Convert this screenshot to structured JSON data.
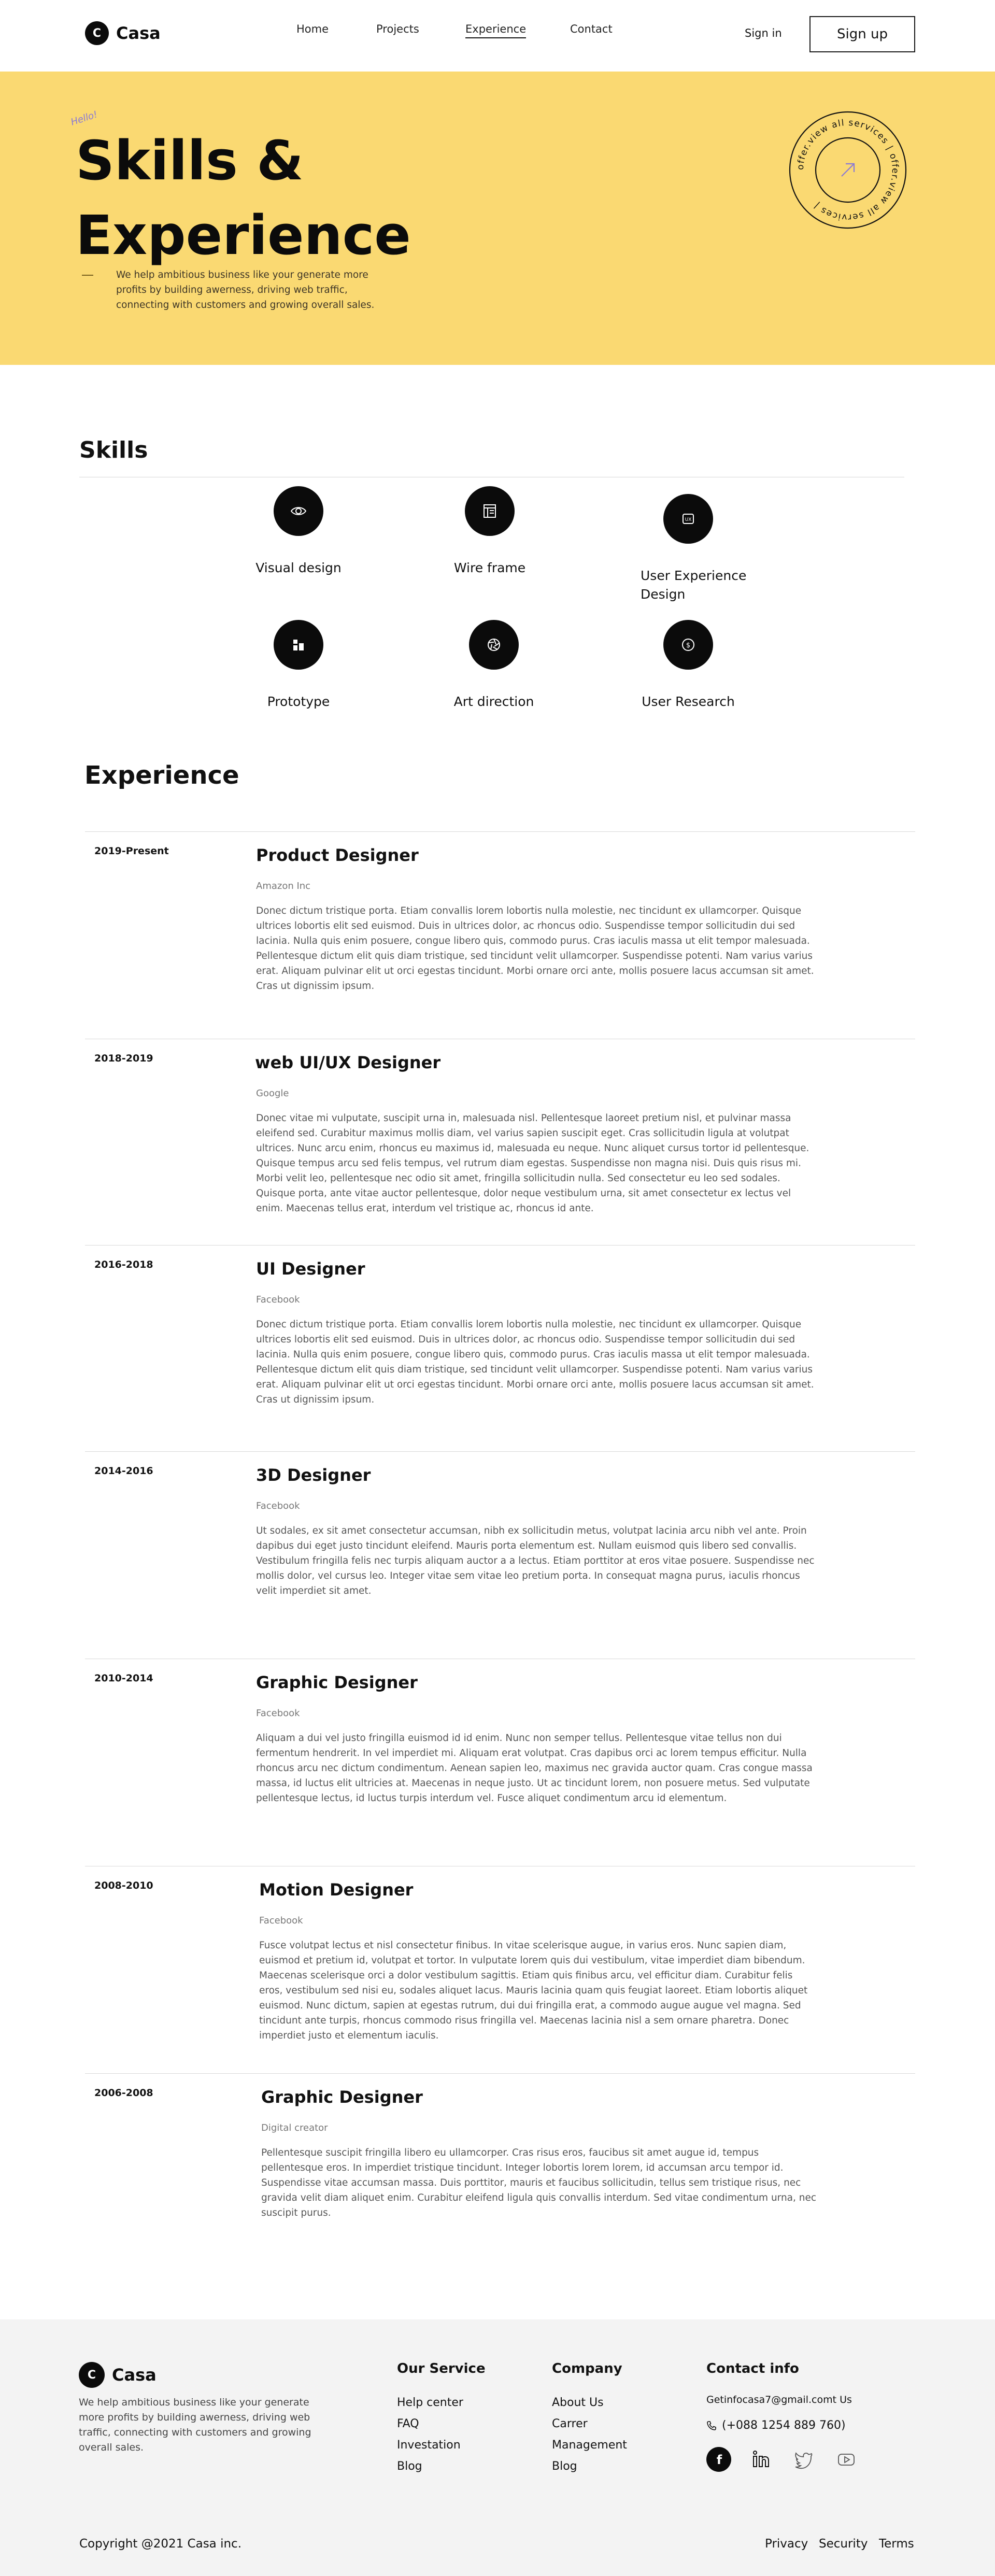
{
  "brand": {
    "logo_letter": "C",
    "name": "Casa"
  },
  "nav": {
    "links": [
      "Home",
      "Projects",
      "Experience",
      "Contact"
    ],
    "active": "Experience",
    "signin": "Sign in",
    "signup": "Sign up"
  },
  "hero": {
    "hello": "Hello!",
    "title_line1": "Skills &",
    "title_line2": "Experience",
    "text": "We help ambitious business like your generate more profits by building awerness, driving web traffic, connecting with customers and growing overall sales.",
    "badge_text": "offer.view all services | offer.view all services |"
  },
  "skills": {
    "title": "Skills",
    "items": [
      {
        "label": "Visual design",
        "icon": "eye-icon"
      },
      {
        "label": "Wire frame",
        "icon": "wireframe-icon"
      },
      {
        "label": "User Experience Design",
        "icon": "ux-icon"
      },
      {
        "label": "Prototype",
        "icon": "prototype-icon"
      },
      {
        "label": "Art direction",
        "icon": "aperture-icon"
      },
      {
        "label": "User Research",
        "icon": "dollar-coin-icon"
      }
    ]
  },
  "experience": {
    "title": "Experience",
    "items": [
      {
        "years": "2019-Present",
        "role": "Product Designer",
        "company": "Amazon Inc",
        "desc": "Donec dictum tristique porta. Etiam convallis lorem lobortis nulla molestie, nec tincidunt ex ullamcorper. Quisque ultrices lobortis elit sed euismod. Duis in ultrices dolor, ac rhoncus odio. Suspendisse tempor sollicitudin dui sed lacinia. Nulla quis enim posuere, congue libero quis, commodo purus. Cras iaculis massa ut elit tempor malesuada. Pellentesque dictum elit quis diam tristique, sed tincidunt velit ullamcorper. Suspendisse potenti. Nam varius varius erat. Aliquam pulvinar elit ut orci egestas tincidunt. Morbi ornare orci ante, mollis posuere lacus accumsan sit amet. Cras ut dignissim ipsum."
      },
      {
        "years": "2018-2019",
        "role": "web UI/UX Designer",
        "company": "Google",
        "desc": "Donec vitae mi vulputate, suscipit urna in, malesuada nisl. Pellentesque laoreet pretium nisl, et pulvinar massa eleifend sed. Curabitur maximus mollis diam, vel varius sapien suscipit eget. Cras sollicitudin ligula at volutpat ultrices. Nunc arcu enim, rhoncus eu maximus id, malesuada eu neque. Nunc aliquet cursus tortor id pellentesque. Quisque tempus arcu sed felis tempus, vel rutrum diam egestas. Suspendisse non magna nisi. Duis quis risus mi. Morbi velit leo, pellentesque nec odio sit amet, fringilla sollicitudin nulla. Sed consectetur eu leo sed sodales. Quisque porta, ante vitae auctor pellentesque, dolor neque vestibulum urna, sit amet consectetur ex lectus vel enim. Maecenas tellus erat, interdum vel tristique ac, rhoncus id ante."
      },
      {
        "years": "2016-2018",
        "role": "UI Designer",
        "company": "Facebook",
        "desc": "Donec dictum tristique porta. Etiam convallis lorem lobortis nulla molestie, nec tincidunt ex ullamcorper. Quisque ultrices lobortis elit sed euismod. Duis in ultrices dolor, ac rhoncus odio. Suspendisse tempor sollicitudin dui sed lacinia. Nulla quis enim posuere, congue libero quis, commodo purus. Cras iaculis massa ut elit tempor malesuada. Pellentesque dictum elit quis diam tristique, sed tincidunt velit ullamcorper. Suspendisse potenti. Nam varius varius erat. Aliquam pulvinar elit ut orci egestas tincidunt. Morbi ornare orci ante, mollis posuere lacus accumsan sit amet. Cras ut dignissim ipsum."
      },
      {
        "years": "2014-2016",
        "role": "3D Designer",
        "company": "Facebook",
        "desc": "Ut sodales, ex sit amet consectetur accumsan, nibh ex sollicitudin metus, volutpat lacinia arcu nibh vel ante. Proin dapibus dui eget justo tincidunt eleifend. Mauris porta elementum est. Nullam euismod quis libero sed convallis. Vestibulum fringilla felis nec turpis aliquam auctor a a lectus. Etiam porttitor at eros vitae posuere. Suspendisse nec mollis dolor, vel cursus leo. Integer vitae sem vitae leo pretium porta. In consequat magna purus, iaculis rhoncus velit imperdiet sit amet."
      },
      {
        "years": "2010-2014",
        "role": "Graphic Designer",
        "company": "Facebook",
        "desc": "Aliquam a dui vel justo fringilla euismod id id enim. Nunc non semper tellus. Pellentesque vitae tellus non dui fermentum hendrerit. In vel imperdiet mi. Aliquam erat volutpat. Cras dapibus orci ac lorem tempus efficitur. Nulla rhoncus arcu nec dictum condimentum. Aenean sapien leo, maximus nec gravida auctor quam. Cras congue massa massa, id luctus elit ultricies at. Maecenas in neque justo. Ut ac tincidunt lorem, non posuere metus. Sed vulputate pellentesque lectus, id luctus turpis interdum vel. Fusce aliquet condimentum arcu id elementum."
      },
      {
        "years": "2008-2010",
        "role": "Motion Designer",
        "company": "Facebook",
        "desc": "Fusce volutpat lectus et nisl consectetur finibus. In vitae scelerisque augue, in varius eros. Nunc sapien diam, euismod et pretium id, volutpat et tortor. In vulputate lorem quis dui vestibulum, vitae imperdiet diam bibendum. Maecenas scelerisque orci a dolor vestibulum sagittis. Etiam quis finibus arcu, vel efficitur diam. Curabitur felis eros, vestibulum sed nisi eu, sodales aliquet lacus. Mauris lacinia quam quis feugiat laoreet. Etiam lobortis aliquet euismod. Nunc dictum, sapien at egestas rutrum, dui dui fringilla erat, a commodo augue augue vel magna. Sed tincidunt ante turpis, rhoncus commodo risus fringilla vel. Maecenas lacinia nisl a sem ornare pharetra. Donec imperdiet justo et elementum iaculis."
      },
      {
        "years": "2006-2008",
        "role": "Graphic Designer",
        "company": "Digital  creator",
        "desc": "Pellentesque suscipit fringilla libero eu ullamcorper. Cras risus eros, faucibus sit amet augue id, tempus pellentesque eros. In imperdiet tristique tincidunt. Integer lobortis lorem lorem, id accumsan arcu tempor id. Suspendisse vitae accumsan massa. Duis porttitor, mauris et faucibus sollicitudin, tellus sem tristique risus, nec gravida velit diam aliquet enim. Curabitur eleifend ligula quis convallis interdum. Sed vitae condimentum urna, nec suscipit purus."
      }
    ]
  },
  "footer": {
    "about": "We help ambitious business like your generate more profits by building awerness, driving web traffic, connecting with customers and growing overall sales.",
    "service": {
      "title": "Our Service",
      "links": [
        "Help center",
        "FAQ",
        "Investation",
        "Blog"
      ]
    },
    "company": {
      "title": "Company",
      "links": [
        "About Us",
        "Carrer",
        "Management",
        "Blog"
      ]
    },
    "contact": {
      "title": "Contact info",
      "email": "Getinfocasa7@gmail.comt Us",
      "phone": "(+088 1254 889  760)",
      "socials": [
        "facebook-icon",
        "linkedin-icon",
        "twitter-icon",
        "youtube-icon"
      ]
    },
    "copyright": "Copyright @2021 Casa inc.",
    "legal": [
      "Privacy",
      "Security",
      "Terms"
    ]
  },
  "colors": {
    "hero_bg": "#fad972",
    "accent": "#0b0b0b",
    "footer_bg": "#f3f3f3"
  }
}
